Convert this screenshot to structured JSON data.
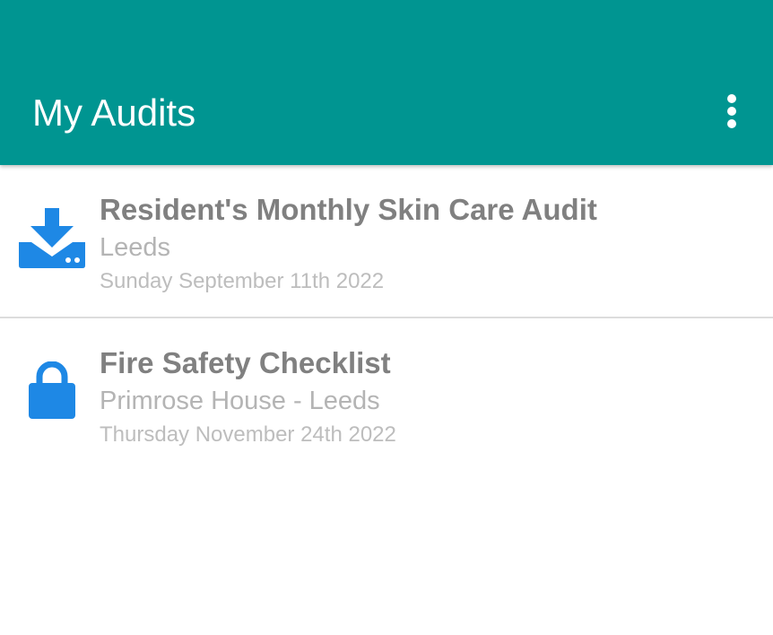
{
  "appbar": {
    "title": "My Audits",
    "background_color": "#009591",
    "menu_icon": "more-vertical-icon"
  },
  "audits": [
    {
      "title": "Resident's Monthly Skin Care Audit",
      "location": "Leeds",
      "date": "Sunday September 11th 2022",
      "icon": "download-icon",
      "icon_color": "#1e88e5"
    },
    {
      "title": "Fire Safety Checklist",
      "location": "Primrose House - Leeds",
      "date": "Thursday November 24th 2022",
      "icon": "lock-icon",
      "icon_color": "#1e88e5"
    }
  ]
}
